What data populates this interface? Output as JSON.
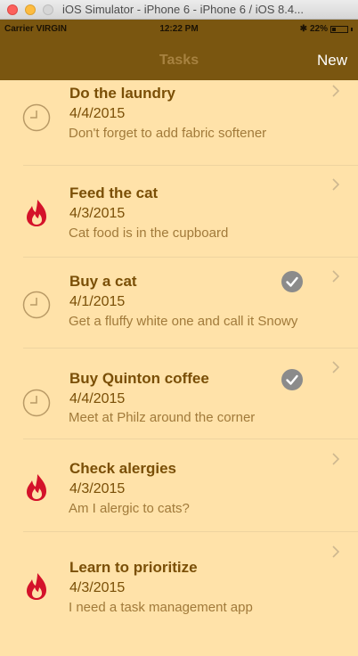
{
  "window": {
    "title": "iOS Simulator - iPhone 6 - iPhone 6 / iOS 8.4..."
  },
  "statusbar": {
    "carrier": "Carrier VIRGIN",
    "time": "12:22 PM",
    "battery": "22%"
  },
  "navbar": {
    "title": "Tasks",
    "new_label": "New"
  },
  "tasks": [
    {
      "title": "Do the laundry",
      "date": "4/4/2015",
      "note": "Don't forget to add fabric softener",
      "icon": "clock-icon",
      "done": false
    },
    {
      "title": "Feed the cat",
      "date": "4/3/2015",
      "note": "Cat food is in the cupboard",
      "icon": "flame-icon",
      "done": false
    },
    {
      "title": "Buy a cat",
      "date": "4/1/2015",
      "note": "Get a fluffy white one and call it Snowy",
      "icon": "clock-icon",
      "done": true
    },
    {
      "title": "Buy Quinton coffee",
      "date": "4/4/2015",
      "note": "Meet at Philz around the corner",
      "icon": "clock-icon",
      "done": true
    },
    {
      "title": "Check alergies",
      "date": "4/3/2015",
      "note": "Am I alergic to cats?",
      "icon": "flame-icon",
      "done": false
    },
    {
      "title": "Learn to prioritize",
      "date": "4/3/2015",
      "note": "I need a task management app",
      "icon": "flame-icon",
      "done": false
    }
  ],
  "colors": {
    "background": "#ffe2a9",
    "bar": "#7a5610",
    "text": "#7a4f07",
    "note": "#a17a3a",
    "flame": "#d4122a",
    "check": "#8b8b8b"
  }
}
